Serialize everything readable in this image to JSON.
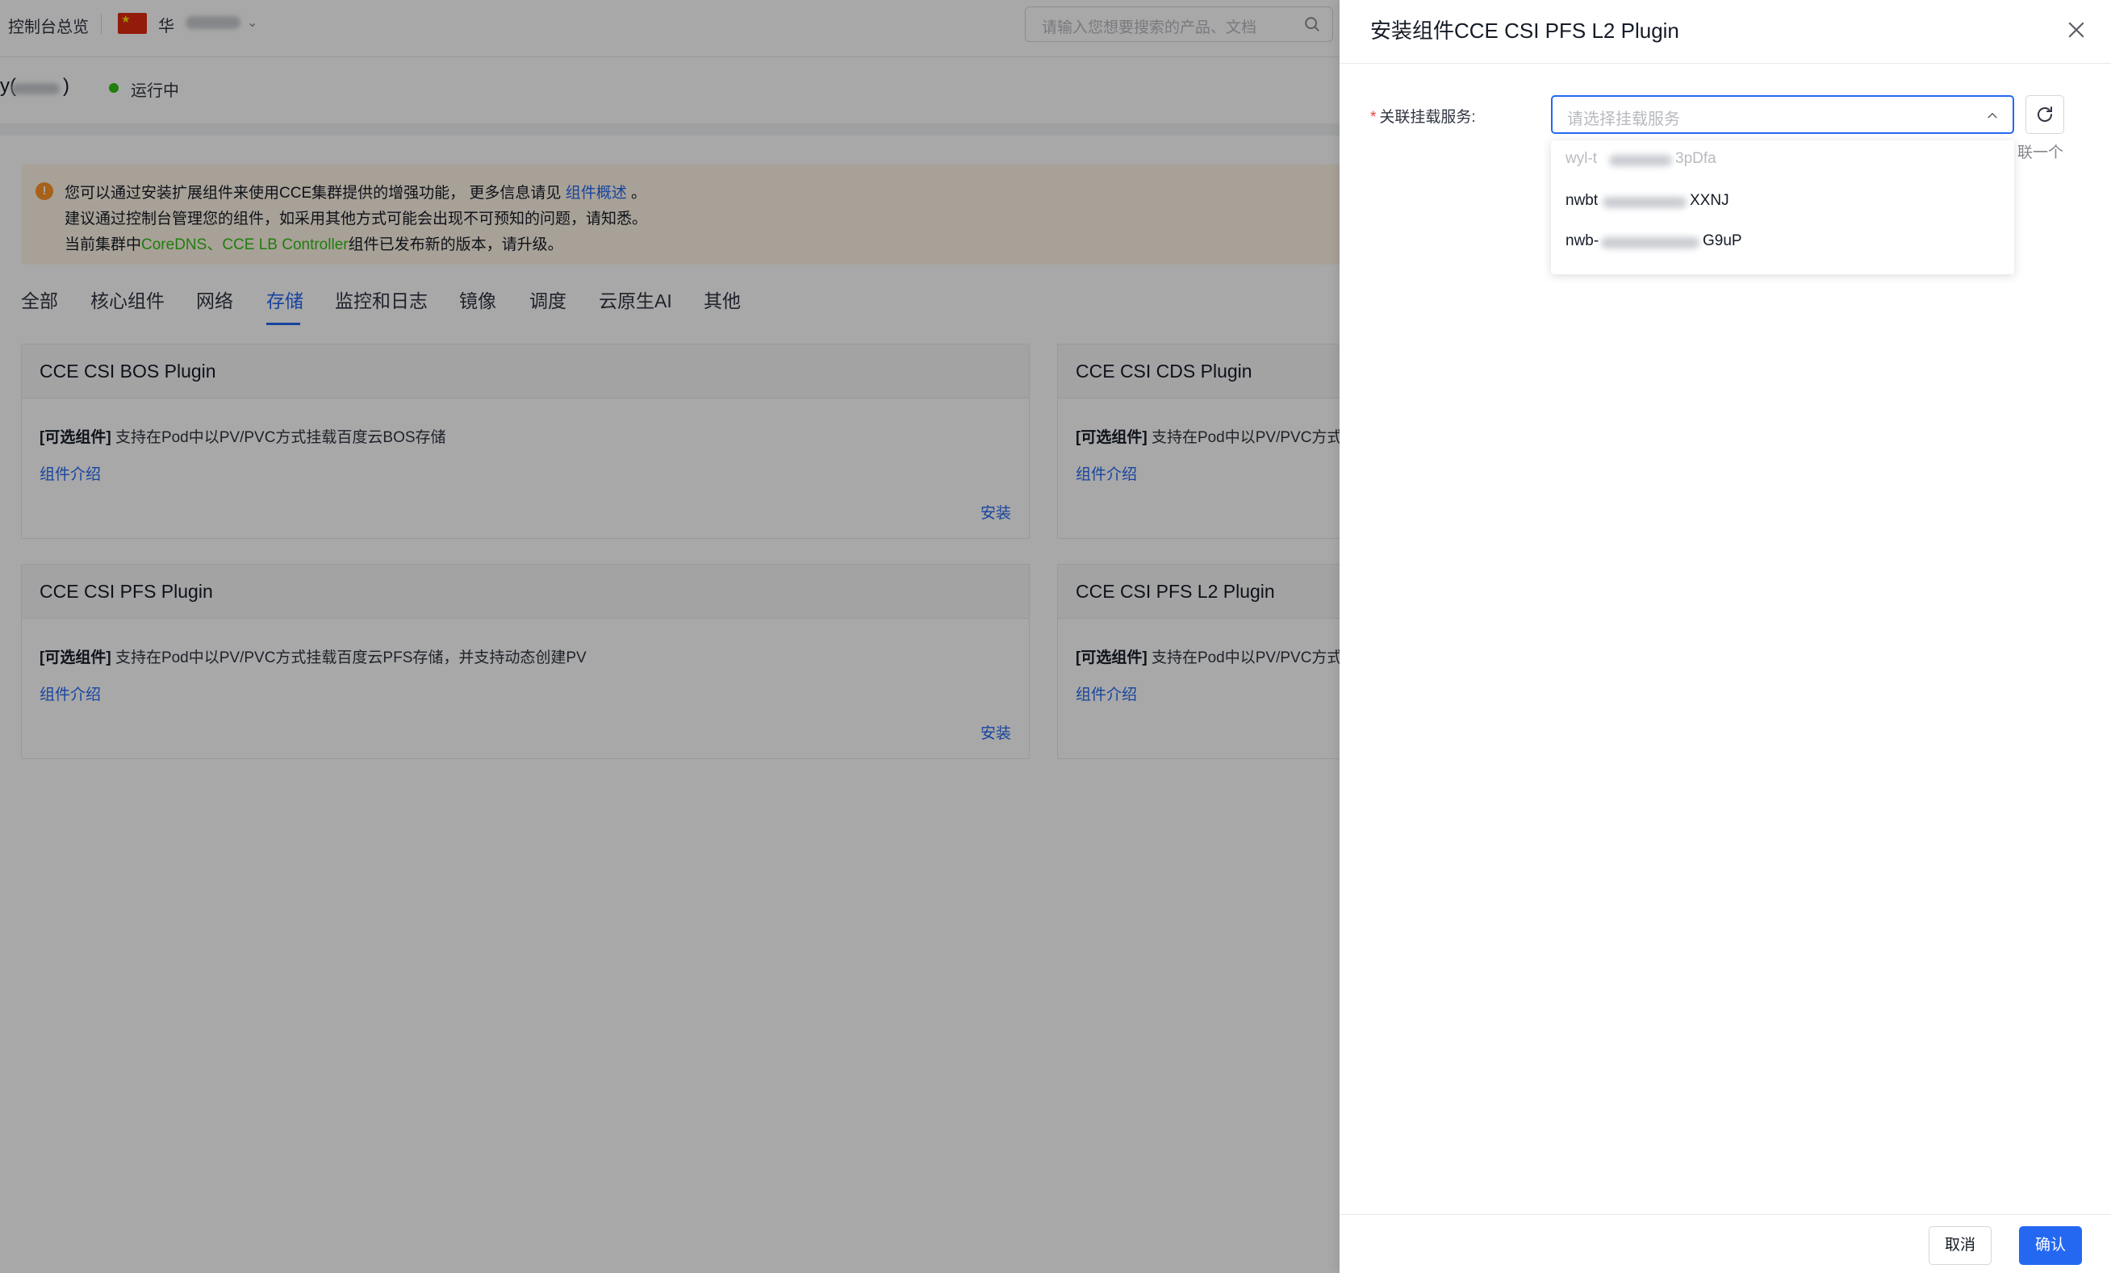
{
  "topbar": {
    "console_label": "控制台总览",
    "region_label": "华",
    "search_placeholder": "请输入您想要搜索的产品、文档"
  },
  "cluster": {
    "name_prefix": "y(",
    "name_suffix": ")",
    "status": "运行中"
  },
  "notice": {
    "line1_text": "您可以通过安装扩展组件来使用CCE集群提供的增强功能， 更多信息请见",
    "line1_link": "组件概述",
    "line1_end": "。",
    "line2": "建议通过控制台管理您的组件，如采用其他方式可能会出现不可预知的问题，请知悉。",
    "line3_start": "当前集群中",
    "line3_highlight": "CoreDNS、CCE LB Controller",
    "line3_end": "组件已发布新的版本，请升级。"
  },
  "tabs": [
    "全部",
    "核心组件",
    "网络",
    "存储",
    "监控和日志",
    "镜像",
    "调度",
    "云原生AI",
    "其他"
  ],
  "active_tab": "存储",
  "cards": [
    {
      "title": "CCE CSI BOS Plugin",
      "tag": "[可选组件]",
      "desc": "支持在Pod中以PV/PVC方式挂载百度云BOS存储",
      "intro": "组件介绍",
      "action": "安装"
    },
    {
      "title": "CCE CSI CDS Plugin",
      "tag": "[可选组件]",
      "desc": "支持在Pod中以PV/PVC方式",
      "intro": "组件介绍",
      "action": ""
    },
    {
      "title": "CCE CSI PFS Plugin",
      "tag": "[可选组件]",
      "desc": "支持在Pod中以PV/PVC方式挂载百度云PFS存储，并支持动态创建PV",
      "intro": "组件介绍",
      "action": "安装"
    },
    {
      "title": "CCE CSI PFS L2 Plugin",
      "tag": "[可选组件]",
      "desc": "支持在Pod中以PV/PVC方式",
      "intro": "组件介绍",
      "action": ""
    }
  ],
  "drawer": {
    "title": "安装组件CCE CSI PFS L2 Plugin",
    "field_label": "关联挂载服务:",
    "select_placeholder": "请选择挂载服务",
    "hint_visible": "联一个",
    "options": [
      {
        "head": "wyl-t",
        "tail": "3pDfa",
        "disabled": true
      },
      {
        "head": "nwbt",
        "tail": "XXNJ",
        "disabled": false
      },
      {
        "head": "nwb-",
        "tail": "G9uP",
        "disabled": false
      }
    ],
    "cancel_label": "取消",
    "confirm_label": "确认"
  },
  "icons": {
    "search": "search-icon",
    "close": "close-icon",
    "refresh": "refresh-icon",
    "chevron_up": "chevron-up-icon",
    "chevron_down": "chevron-down-icon",
    "warning": "warning-icon",
    "flag": "china-flag-icon"
  },
  "colors": {
    "primary": "#2468f2",
    "success": "#30bf13",
    "warning": "#ff9326",
    "required": "#f33e3e"
  }
}
